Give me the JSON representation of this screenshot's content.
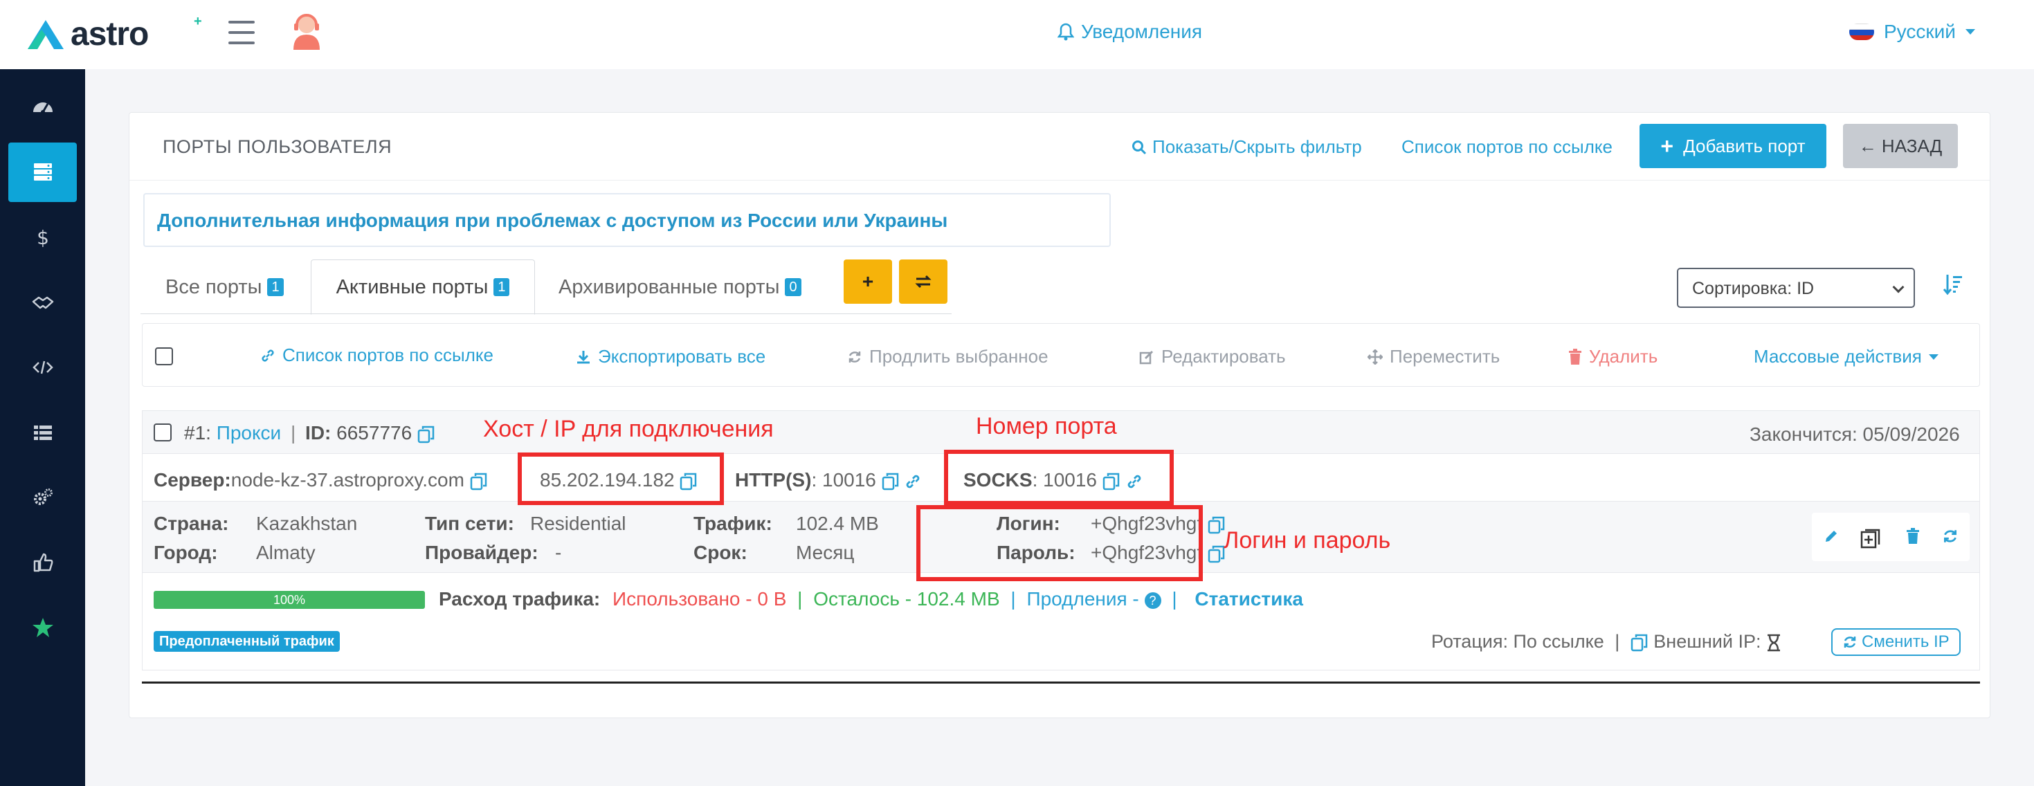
{
  "header": {
    "logo_text": "astro",
    "notifications_label": "Уведомления",
    "language_label": "Русский"
  },
  "sidebar": {
    "items": [
      "dashboard-icon",
      "ports-icon",
      "dollar-icon",
      "handshake-icon",
      "code-icon",
      "list-icon",
      "gears-icon",
      "thumbs-up-icon",
      "star-icon"
    ]
  },
  "card": {
    "title": "ПОРТЫ ПОЛЬЗОВАТЕЛЯ",
    "toggle_filter": "Показать/Скрыть фильтр",
    "ports_by_link": "Список портов по ссылке",
    "add_port": "Добавить порт",
    "back": "← НАЗАД",
    "info_text": "Дополнительная информация при проблемах с доступом из России или Украины"
  },
  "tabs": [
    {
      "label": "Все порты",
      "count": "1"
    },
    {
      "label": "Активные порты",
      "count": "1"
    },
    {
      "label": "Архивированные порты",
      "count": "0"
    }
  ],
  "sort": {
    "label": "Сортировка: ID"
  },
  "actions": {
    "ports_by_link": "Список портов по ссылке",
    "export_all": "Экспортировать все",
    "extend_selected": "Продлить выбранное",
    "edit": "Редактировать",
    "move": "Переместить",
    "delete": "Удалить",
    "bulk": "Массовые действия"
  },
  "port": {
    "number": "#1:",
    "type": "Прокси",
    "id_label": "ID:",
    "id": "6657776",
    "expires": "Закончится: 05/09/2026",
    "server_label": "Сервер:",
    "server": "node-kz-37.astroproxy.com",
    "ip": "85.202.194.182",
    "http_label": "HTTP(S)",
    "http_port": ": 10016",
    "socks_label": "SOCKS",
    "socks_port": ": 10016",
    "country_label": "Страна:",
    "country": "Kazakhstan",
    "city_label": "Город:",
    "city": "Almaty",
    "net_label": "Тип сети:",
    "net": "Residential",
    "provider_label": "Провайдер:",
    "provider": "-",
    "traffic_label": "Трафик:",
    "traffic": "102.4 MB",
    "term_label": "Срок:",
    "term": "Месяц",
    "login_label": "Логин:",
    "login": "+Qhgf23vhgf",
    "password_label": "Пароль:",
    "password": "+Qhgf23vhgf",
    "progress_text": "100%",
    "progress_value": 1.0,
    "usage_label": "Расход трафика:",
    "used": "Использовано - 0 B",
    "left": "Осталось - 102.4 MB",
    "renewals": "Продления -",
    "stats": "Статистика",
    "prepaid": "Предоплаченный трафик",
    "rotation": "Ротация: По ссылке",
    "external_ip": "Внешний IP:",
    "change_ip": "Сменить IP"
  },
  "annotations": {
    "host": "Хост / IP для подключения",
    "port": "Номер порта",
    "credentials": "Логин и пароль"
  },
  "colors": {
    "accent": "#1ea5d9",
    "sidebar": "#0b1a33",
    "warning": "#f6b30a",
    "annotation": "#ee2b2b"
  }
}
